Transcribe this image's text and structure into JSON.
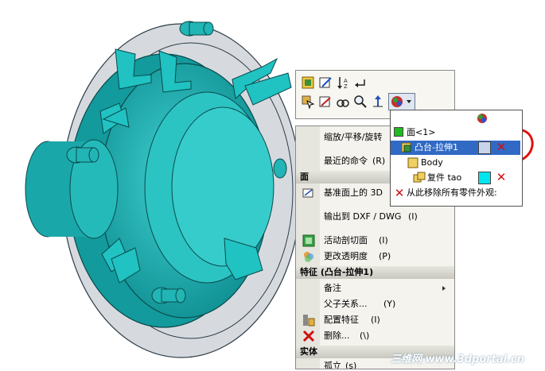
{
  "toolbar": {
    "icons": [
      "edit-part-icon",
      "edit-sketch-icon",
      "sort-icon",
      "return-icon",
      "select-icon",
      "sketch-icon",
      "view-icon",
      "zoom-icon",
      "normal-to-icon",
      "appearance-icon"
    ]
  },
  "appearance_popup": {
    "items": [
      {
        "label": "面<1>",
        "color": "#22bb22"
      },
      {
        "label": "凸台-拉伸1",
        "color": "#c8d4ec",
        "selected": true
      },
      {
        "label": "Body",
        "color": "#f0d060"
      },
      {
        "label": "复件 tao",
        "color": "#00e5ee"
      }
    ],
    "remove_all_label": "从此移除所有零件外观:"
  },
  "context_menu": {
    "items_top": [
      {
        "label": "缩放/平移/旋转",
        "key": ""
      },
      {
        "label": "最近的命令",
        "key": "(R)"
      }
    ],
    "header_face": "面",
    "items_face": [
      {
        "label": "基准面上的 3D",
        "key": ""
      },
      {
        "label": "输出到 DXF / DWG",
        "key": "(I)"
      },
      {
        "label": "活动剖切面",
        "key": "(I)"
      },
      {
        "label": "更改透明度",
        "key": "(P)"
      }
    ],
    "header_feature": "特征 (凸台-拉伸1)",
    "items_feature": [
      {
        "label": "备注",
        "key": ""
      },
      {
        "label": "父子关系...",
        "key": "(Y)"
      },
      {
        "label": "配置特征",
        "key": "(I)"
      },
      {
        "label": "删除...",
        "key": "(\\)"
      }
    ],
    "header_body": "实体",
    "items_body": [
      {
        "label": "孤立",
        "key": "(s)"
      }
    ]
  },
  "watermark": "三维网 www.3dportal.cn",
  "colors": {
    "part_teal": "#1fb1b1",
    "annotation_red": "#e01010",
    "selection_blue": "#316ac5"
  }
}
